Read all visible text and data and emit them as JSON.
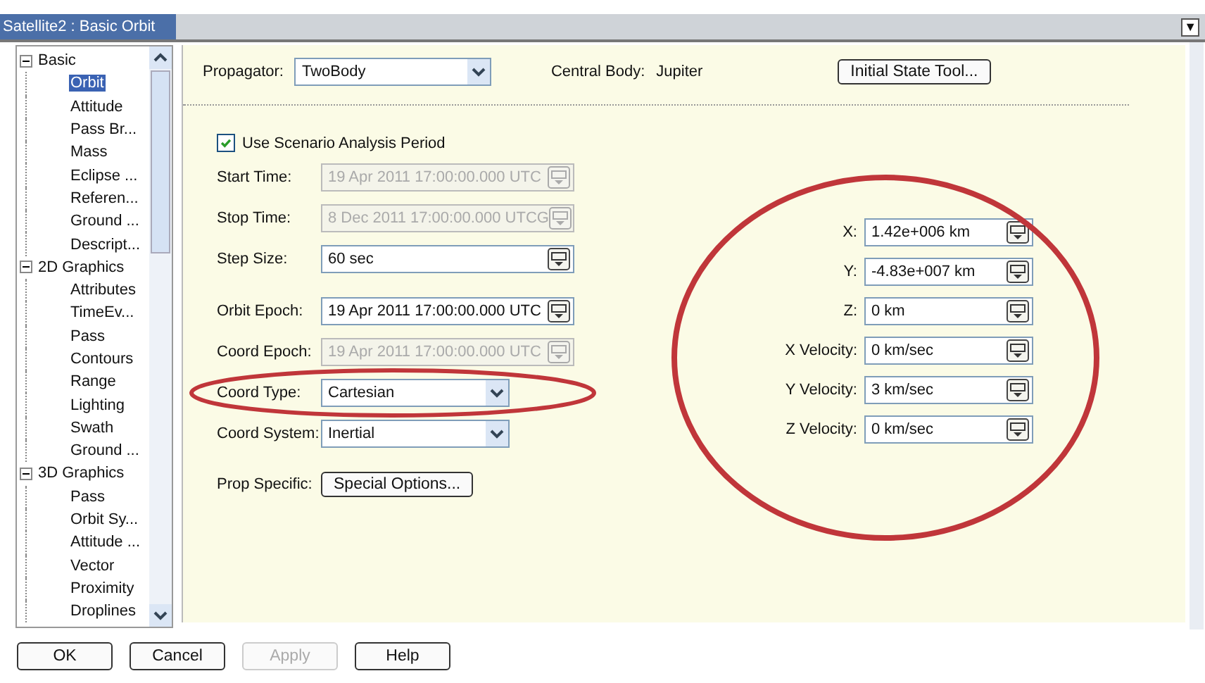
{
  "window": {
    "title": "Satellite2 : Basic Orbit",
    "menu_arrow": "▼"
  },
  "tree": [
    {
      "label": "Basic",
      "expanded": true,
      "selected": false,
      "children": [
        {
          "label": "Orbit",
          "selected": true
        },
        {
          "label": "Attitude",
          "selected": false
        },
        {
          "label": "Pass Br...",
          "selected": false
        },
        {
          "label": "Mass",
          "selected": false
        },
        {
          "label": "Eclipse ...",
          "selected": false
        },
        {
          "label": "Referen...",
          "selected": false
        },
        {
          "label": "Ground ...",
          "selected": false
        },
        {
          "label": "Descript...",
          "selected": false
        }
      ]
    },
    {
      "label": "2D Graphics",
      "expanded": true,
      "selected": false,
      "children": [
        {
          "label": "Attributes",
          "selected": false
        },
        {
          "label": "TimeEv...",
          "selected": false
        },
        {
          "label": "Pass",
          "selected": false
        },
        {
          "label": "Contours",
          "selected": false
        },
        {
          "label": "Range",
          "selected": false
        },
        {
          "label": "Lighting",
          "selected": false
        },
        {
          "label": "Swath",
          "selected": false
        },
        {
          "label": "Ground ...",
          "selected": false
        }
      ]
    },
    {
      "label": "3D Graphics",
      "expanded": true,
      "selected": false,
      "children": [
        {
          "label": "Pass",
          "selected": false
        },
        {
          "label": "Orbit Sy...",
          "selected": false
        },
        {
          "label": "Attitude ...",
          "selected": false
        },
        {
          "label": "Vector",
          "selected": false
        },
        {
          "label": "Proximity",
          "selected": false
        },
        {
          "label": "Droplines",
          "selected": false
        }
      ]
    }
  ],
  "header": {
    "propagator_label": "Propagator:",
    "propagator": "TwoBody",
    "central_body_label": "Central Body:",
    "central_body": "Jupiter",
    "tool_button": "Initial State Tool..."
  },
  "use_period": {
    "label": "Use Scenario Analysis Period",
    "checked": true
  },
  "left_fields": [
    {
      "kind": "unit",
      "label": "Start Time:",
      "value": "19 Apr 2011 17:00:00.000 UTC",
      "disabled": true
    },
    {
      "kind": "unit",
      "label": "Stop Time:",
      "value": "8 Dec 2011 17:00:00.000 UTCG",
      "disabled": true
    },
    {
      "kind": "unit",
      "label": "Step Size:",
      "value": "60 sec",
      "disabled": false
    },
    {
      "kind": "unit",
      "label": "Orbit Epoch:",
      "value": "19 Apr 2011 17:00:00.000 UTC",
      "disabled": false
    },
    {
      "kind": "unit",
      "label": "Coord Epoch:",
      "value": "19 Apr 2011 17:00:00.000 UTC",
      "disabled": true
    },
    {
      "kind": "dropdown",
      "label": "Coord Type:",
      "value": "Cartesian",
      "disabled": false
    },
    {
      "kind": "dropdown",
      "label": "Coord System:",
      "value": "Inertial",
      "disabled": false
    },
    {
      "kind": "button",
      "label": "Prop Specific:",
      "value": "Special Options...",
      "disabled": false
    }
  ],
  "right_fields": [
    {
      "label": "X:",
      "value": "1.42e+006 km"
    },
    {
      "label": "Y:",
      "value": "-4.83e+007 km"
    },
    {
      "label": "Z:",
      "value": "0 km"
    },
    {
      "label": "X Velocity:",
      "value": "0 km/sec"
    },
    {
      "label": "Y Velocity:",
      "value": "3 km/sec"
    },
    {
      "label": "Z Velocity:",
      "value": "0 km/sec"
    }
  ],
  "annotations": [
    {
      "kind": "ellipse",
      "color": "#c0363a"
    },
    {
      "kind": "ellipse",
      "color": "#c0363a"
    }
  ],
  "buttons": [
    {
      "label": "OK",
      "disabled": false
    },
    {
      "label": "Cancel",
      "disabled": false
    },
    {
      "label": "Apply",
      "disabled": true
    },
    {
      "label": "Help",
      "disabled": false
    }
  ]
}
